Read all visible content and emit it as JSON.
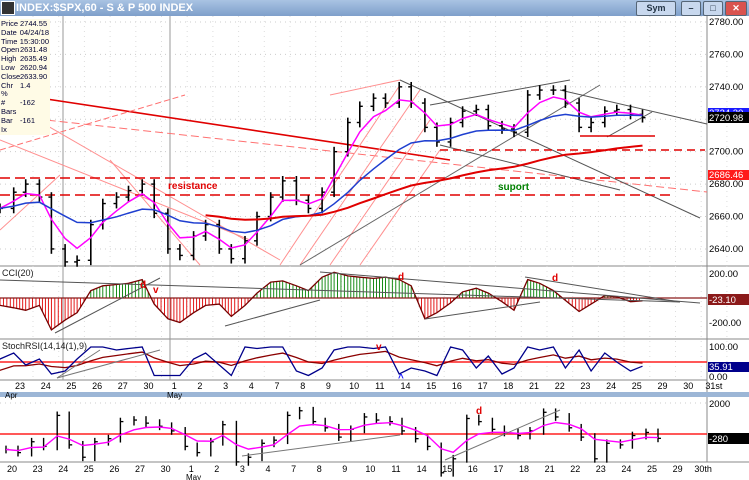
{
  "window": {
    "title": "INDEX:$SPX,60 - S & P 500 INDEX",
    "sym_button": "Sym",
    "minimize": "–",
    "maximize": "□",
    "close": "✕"
  },
  "info": [
    {
      "k": "Price",
      "v": "2744.55"
    },
    {
      "k": "Date",
      "v": "04/24/18"
    },
    {
      "k": "Time",
      "v": "15:30:00"
    },
    {
      "k": "Open",
      "v": "2631.48"
    },
    {
      "k": "High",
      "v": "2635.49"
    },
    {
      "k": "Low",
      "v": "2620.94"
    },
    {
      "k": "Close",
      "v": "2633.90"
    },
    {
      "k": "Chr %",
      "v": "1.4"
    },
    {
      "k": "# Bars",
      "v": "-162"
    },
    {
      "k": "Bar Ix",
      "v": "-161"
    }
  ],
  "colors": {
    "price": "#000000",
    "fast_ma": "#ff00ff",
    "mid_ma": "#1f3fd0",
    "slow_ma": "#e00000",
    "cci_pos": "#008000",
    "cci_neg": "#e00000",
    "stoch": "#00008b",
    "stoch_signal": "#8b0000",
    "zero_line": "#ff2020"
  },
  "chart_data": [
    {
      "type": "ohlc",
      "title": "INDEX:$SPX,60 - S & P 500 INDEX",
      "ylim": [
        2630,
        2790
      ],
      "y_ticks": [
        "2780.00",
        "2760.00",
        "2740.00",
        "2720.00",
        "2700.00",
        "2680.00",
        "2660.00",
        "2640.00"
      ],
      "last_labels": {
        "blue_ma": "2724.20",
        "close": "2720.98",
        "red_ma": "2686.46"
      },
      "annotations": {
        "resistance": "resistance",
        "support": "suport"
      },
      "dates": [
        "04-20",
        "04-23",
        "04-24",
        "04-25",
        "04-26",
        "04-27",
        "04-30",
        "05-01",
        "05-02",
        "05-03",
        "05-04",
        "05-07",
        "05-08",
        "05-09",
        "05-10",
        "05-11",
        "05-14",
        "05-15",
        "05-16",
        "05-17",
        "05-18",
        "05-21",
        "05-22",
        "05-23",
        "05-24",
        "05-25"
      ],
      "close_am_pm": [
        [
          2665,
          2665
        ],
        [
          2675,
          2680
        ],
        [
          2672,
          2640
        ],
        [
          2632,
          2633
        ],
        [
          2655,
          2668
        ],
        [
          2672,
          2676
        ],
        [
          2680,
          2662
        ],
        [
          2640,
          2636
        ],
        [
          2648,
          2655
        ],
        [
          2640,
          2634
        ],
        [
          2645,
          2660
        ],
        [
          2672,
          2682
        ],
        [
          2670,
          2665
        ],
        [
          2675,
          2700
        ],
        [
          2718,
          2728
        ],
        [
          2733,
          2730
        ],
        [
          2740,
          2730
        ],
        [
          2715,
          2706
        ],
        [
          2718,
          2725
        ],
        [
          2726,
          2716
        ],
        [
          2714,
          2712
        ],
        [
          2735,
          2738
        ],
        [
          2738,
          2730
        ],
        [
          2715,
          2718
        ],
        [
          2725,
          2726
        ],
        [
          2723,
          2720.98
        ]
      ],
      "grid": true
    },
    {
      "type": "bar",
      "title": "CCI(20)",
      "ylim": [
        -250,
        250
      ],
      "y_ticks": [
        "200.00",
        "0.00",
        "-200.00"
      ],
      "last_label": "-23.10",
      "annotations": [
        "d",
        "v",
        "d",
        "d"
      ],
      "values_am_pm": [
        [
          -50,
          -60
        ],
        [
          -80,
          -100
        ],
        [
          -60,
          -260
        ],
        [
          -180,
          -120
        ],
        [
          60,
          100
        ],
        [
          110,
          120
        ],
        [
          150,
          -50
        ],
        [
          -170,
          -200
        ],
        [
          -120,
          -60
        ],
        [
          -50,
          -150
        ],
        [
          -60,
          40
        ],
        [
          130,
          140
        ],
        [
          100,
          60
        ],
        [
          170,
          210
        ],
        [
          180,
          170
        ],
        [
          160,
          170
        ],
        [
          150,
          100
        ],
        [
          -170,
          -120
        ],
        [
          -40,
          50
        ],
        [
          80,
          40
        ],
        [
          -30,
          -100
        ],
        [
          150,
          120
        ],
        [
          60,
          -20
        ],
        [
          -110,
          -50
        ],
        [
          20,
          10
        ],
        [
          -30,
          -23.1
        ]
      ]
    },
    {
      "type": "line",
      "title": "StochRSI(14,14(1),9)",
      "ylim": [
        0,
        100
      ],
      "y_ticks": [
        "100.00",
        "0.00"
      ],
      "last_label": "35.91",
      "annotations": [
        "v",
        "^"
      ],
      "values_am_pm": [
        [
          10,
          60
        ],
        [
          80,
          40
        ],
        [
          60,
          10
        ],
        [
          20,
          60
        ],
        [
          100,
          100
        ],
        [
          90,
          95
        ],
        [
          100,
          5
        ],
        [
          5,
          5
        ],
        [
          60,
          80
        ],
        [
          40,
          5
        ],
        [
          100,
          95
        ],
        [
          100,
          100
        ],
        [
          20,
          5
        ],
        [
          30,
          90
        ],
        [
          100,
          100
        ],
        [
          95,
          100
        ],
        [
          10,
          30
        ],
        [
          20,
          5
        ],
        [
          100,
          90
        ],
        [
          30,
          70
        ],
        [
          10,
          30
        ],
        [
          100,
          90
        ],
        [
          100,
          30
        ],
        [
          90,
          20
        ],
        [
          80,
          50
        ],
        [
          20,
          35.91
        ]
      ]
    },
    {
      "type": "ohlc",
      "y_ticks": [
        "2000"
      ],
      "last_label": "-280",
      "annotations": [
        "d"
      ],
      "values_am_pm": [
        [
          -1000,
          -1200
        ],
        [
          -500,
          -800
        ],
        [
          1200,
          -700
        ],
        [
          -1500,
          -500
        ],
        [
          -300,
          800
        ],
        [
          900,
          700
        ],
        [
          500,
          200
        ],
        [
          -800,
          -1200
        ],
        [
          -500,
          600
        ],
        [
          -1800,
          -1500
        ],
        [
          -600,
          -400
        ],
        [
          1200,
          1500
        ],
        [
          800,
          400
        ],
        [
          -200,
          300
        ],
        [
          1100,
          900
        ],
        [
          800,
          200
        ],
        [
          -300,
          -800
        ],
        [
          -2500,
          -1600
        ],
        [
          1000,
          800
        ],
        [
          300,
          100
        ],
        [
          -100,
          200
        ],
        [
          1400,
          1100
        ],
        [
          400,
          -200
        ],
        [
          -1600,
          -600
        ],
        [
          -700,
          -100
        ],
        [
          100,
          -280
        ]
      ]
    }
  ],
  "x_axis_top": {
    "labels": [
      "23",
      "24",
      "25",
      "26",
      "27",
      "30",
      "1",
      "2",
      "3",
      "4",
      "7",
      "8",
      "9",
      "10",
      "11",
      "14",
      "15",
      "16",
      "17",
      "18",
      "21",
      "22",
      "23",
      "24",
      "25",
      "29",
      "30",
      "31st"
    ],
    "months": [
      "Apr",
      "May"
    ]
  },
  "x_axis_bottom": {
    "labels": [
      "20",
      "23",
      "24",
      "25",
      "26",
      "27",
      "30",
      "1",
      "2",
      "3",
      "4",
      "7",
      "8",
      "9",
      "10",
      "11",
      "14",
      "15",
      "16",
      "17",
      "18",
      "21",
      "22",
      "23",
      "24",
      "25",
      "29",
      "30th"
    ],
    "months": [
      "May"
    ]
  }
}
